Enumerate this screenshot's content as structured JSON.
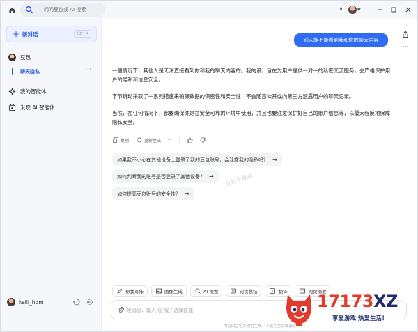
{
  "titlebar": {
    "search_placeholder": "问问豆包或 AI 搜索",
    "icons": [
      "home-icon",
      "search-icon",
      "pin-icon",
      "avatar",
      "minimize-icon",
      "maximize-icon",
      "close-icon"
    ]
  },
  "sidebar": {
    "new_chat": {
      "label": "新对话",
      "shortcut": "Ctrl K"
    },
    "items": [
      {
        "label": "豆包",
        "icon": "doubao-avatar"
      },
      {
        "label": "聊天隐私",
        "icon": "none",
        "active": true
      },
      {
        "label": "我的智能体",
        "icon": "sparkle-icon"
      },
      {
        "label": "发现 AI 智能体",
        "icon": "discover-icon"
      }
    ],
    "user": {
      "name": "kaili_hdm"
    }
  },
  "chat": {
    "user_message": "别人能不能看到我和你的聊天内容",
    "reply_paragraphs": [
      "一般情况下，其他人是无法直接看到你和我的聊天内容的。我的设计旨在为用户提供一对一的私密交流服务，会严格保护用户的隐私和信息安全。",
      "字节跳动采取了一系列措施来确保数据的保密性和安全性，不会随意公开或向第三方透露用户的聊天记录。",
      "当然，在任何情况下，都要确保你是在安全可靠的环境中使用，并且也要注意保护好自己的账户信息等，以最大程度地保障隐私安全。"
    ],
    "actions": {
      "copy": "复制",
      "regenerate": "重新生成"
    },
    "suggestions": [
      "如果我不小心在其他设备上登录了我的豆包账号，会泄露我的隐私吗？",
      "如何判断我的账号是否登录了其他设备？",
      "如何提高豆包账号的安全性？"
    ],
    "watermark": "豆包下载站"
  },
  "toolbar": {
    "tools": [
      {
        "label": "帮我写作",
        "icon": "pen-icon"
      },
      {
        "label": "图像生成",
        "icon": "image-icon"
      },
      {
        "label": "AI 搜索",
        "icon": "ai-search-icon"
      },
      {
        "label": "阅读总结",
        "icon": "read-icon"
      },
      {
        "label": "翻译",
        "icon": "translate-icon"
      },
      {
        "label": "网页摘要",
        "icon": "web-icon"
      }
    ]
  },
  "input": {
    "placeholder": "发消息、输入 @ 或 / 选择技能",
    "footnote": "内容由豆包大模型生成，不能完全保障真实"
  },
  "logo": {
    "main_number": "17173",
    "main_letters": "XZ",
    "tagline": "享爱游戏 热爱生活！"
  },
  "colors": {
    "accent": "#2e5fe0",
    "user_bubble": "#2f6bf3",
    "logo_red": "#e23a2c",
    "logo_navy": "#1f2a6b"
  }
}
